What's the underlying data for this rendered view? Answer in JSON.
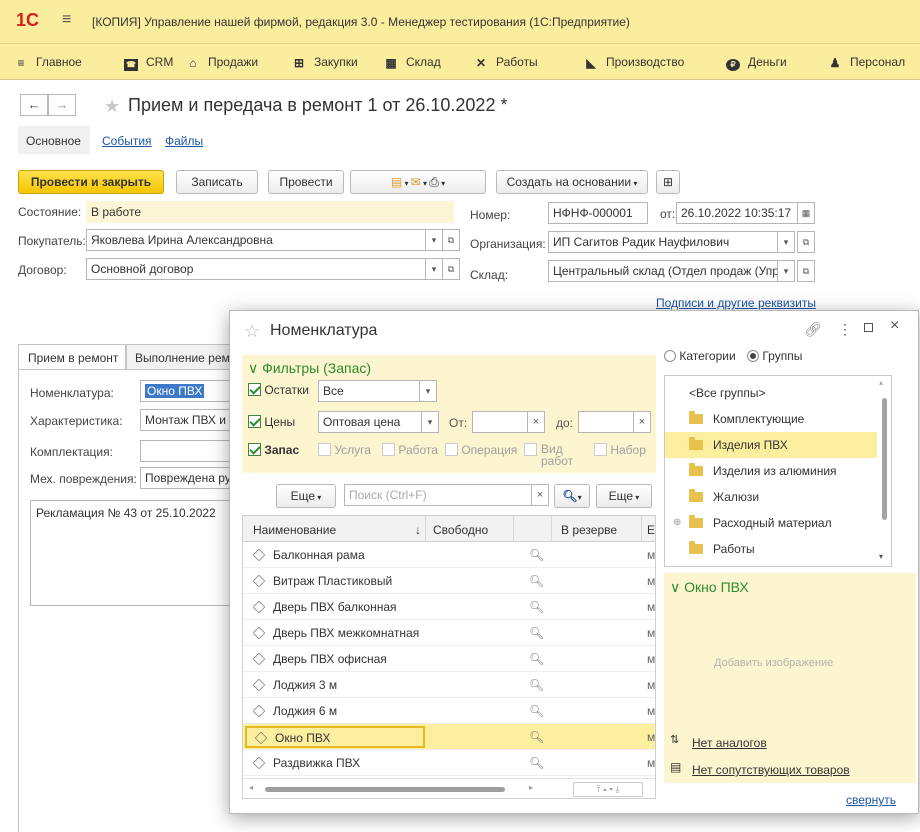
{
  "app": {
    "logo": "1С",
    "window_title": "[КОПИЯ] Управление нашей фирмой, редакция 3.0 - Менеджер тестирования (1С:Предприятие)"
  },
  "menu": [
    {
      "label": "Главное",
      "icon": "menu-icon"
    },
    {
      "label": "CRM",
      "icon": "crm-icon"
    },
    {
      "label": "Продажи",
      "icon": "sales-icon"
    },
    {
      "label": "Закупки",
      "icon": "purchases-icon"
    },
    {
      "label": "Склад",
      "icon": "warehouse-icon"
    },
    {
      "label": "Работы",
      "icon": "tools-icon"
    },
    {
      "label": "Производство",
      "icon": "production-icon"
    },
    {
      "label": "Деньги",
      "icon": "money-icon"
    },
    {
      "label": "Персонал",
      "icon": "staff-icon"
    }
  ],
  "document": {
    "title": "Прием и передача в ремонт 1 от 26.10.2022 *",
    "tabs": [
      "Основное",
      "События",
      "Файлы"
    ],
    "toolbar": {
      "post_close": "Провести и закрыть",
      "save": "Записать",
      "post": "Провести",
      "create_based": "Создать на основании"
    },
    "fields": {
      "state_label": "Состояние:",
      "state_value": "В работе",
      "number_label": "Номер:",
      "number_value": "НФНФ-000001",
      "date_label": "от:",
      "date_value": "26.10.2022 10:35:17",
      "buyer_label": "Покупатель:",
      "buyer_value": "Яковлева Ирина Александровна",
      "org_label": "Организация:",
      "org_value": "ИП Сагитов Радик Науфилович",
      "contract_label": "Договор:",
      "contract_value": "Основной договор",
      "warehouse_label": "Склад:",
      "warehouse_value": "Центральный склад (Отдел продаж (Упр",
      "signatures_link": "Подписи и другие реквизиты"
    },
    "inner_tabs": [
      "Прием в ремонт",
      "Выполнение ремо"
    ],
    "repair": {
      "nomenclature_label": "Номенклатура:",
      "nomenclature_value": "Окно ПВХ",
      "characteristic_label": "Характеристика:",
      "characteristic_value": "Монтаж ПВХ и а",
      "kit_label": "Комплектация:",
      "kit_value": "",
      "damage_label": "Мех. повреждения:",
      "damage_value": "Повреждена ру",
      "comment": "Рекламация № 43 от 25.10.2022"
    }
  },
  "popup": {
    "title": "Номенклатура",
    "filters_header": "Фильтры (Запас)",
    "stock_label": "Остатки",
    "stock_value": "Все",
    "prices_label": "Цены",
    "prices_value": "Оптовая цена",
    "from_label": "От:",
    "to_label": "до:",
    "types": [
      "Запас",
      "Услуга",
      "Работа",
      "Операция",
      "Вид работ",
      "Набор"
    ],
    "more_label": "Еще",
    "search_placeholder": "Поиск (Ctrl+F)",
    "columns": [
      "Наименование",
      "Свободно",
      "В резерве",
      "Е"
    ],
    "sort_icon": "↓",
    "items": [
      "Балконная рама",
      "Витраж Пластиковый",
      "Дверь ПВХ балконная",
      "Дверь ПВХ межкомнатная",
      "Дверь ПВХ офисная",
      "Лоджия 3 м",
      "Лоджия 6 м",
      "Окно ПВХ",
      "Раздвижка ПВХ"
    ],
    "unit_col_text": "м",
    "selected_item": "Окно ПВХ",
    "grouping": {
      "categories": "Категории",
      "groups": "Группы",
      "selected": "Группы"
    },
    "groups": [
      "<Все группы>",
      "Комплектующие",
      "Изделия ПВХ",
      "Изделия из алюминия",
      "Жалюзи",
      "Расходный материал",
      "Работы"
    ],
    "selected_group": "Изделия ПВХ",
    "preview": {
      "title": "Окно ПВХ",
      "add_image": "Добавить изображение",
      "analogs": "Нет аналогов",
      "related": "Нет сопутствующих товаров",
      "collapse": "свернуть"
    }
  },
  "colors": {
    "accent_yellow": "#fbed9e",
    "primary_button": "#f6c600",
    "selection": "#fcef9f",
    "link": "#1c55a6",
    "check_green": "#2e8b2e"
  }
}
